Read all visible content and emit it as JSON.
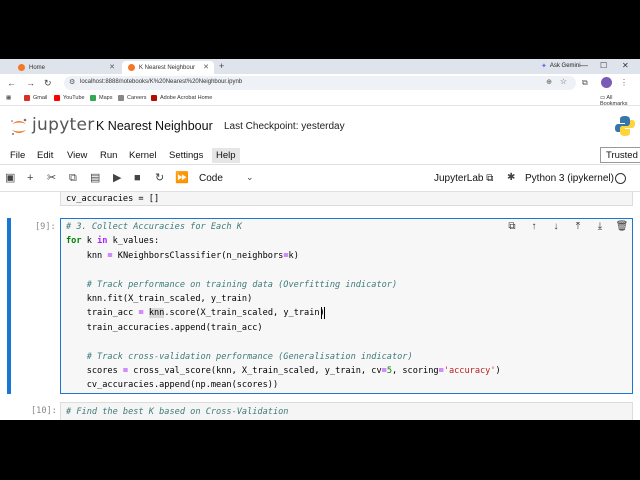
{
  "browser": {
    "tabs": [
      {
        "label": "Home",
        "active": false
      },
      {
        "label": "K Nearest Neighbour",
        "active": true
      }
    ],
    "new_tab": "+",
    "ask_gemini": "Ask Gemini",
    "url": "localhost:8888/notebooks/K%20Nearest%20Neighbour.ipynb",
    "bookmarks": [
      {
        "label": "Gmail",
        "color": "#d93025"
      },
      {
        "label": "YouTube",
        "color": "#ff0000"
      },
      {
        "label": "Maps",
        "color": "#34a853"
      },
      {
        "label": "Careers",
        "color": "#888888"
      },
      {
        "label": "Adobe Acrobat Home",
        "color": "#b30b00"
      }
    ],
    "all_bookmarks": "All Bookmarks"
  },
  "jupyter": {
    "brand": "jupyter",
    "notebook_title": "K Nearest Neighbour",
    "checkpoint": "Last Checkpoint: yesterday",
    "trusted": "Trusted",
    "menu": [
      "File",
      "Edit",
      "View",
      "Run",
      "Kernel",
      "Settings",
      "Help"
    ],
    "active_menu": "Help",
    "cell_type": "Code",
    "jupyterlab_label": "JupyterLab",
    "kernel_name": "Python 3 (ipykernel)",
    "accent": "#1976d2"
  },
  "cells": {
    "previous_line": "cv_accuracies = []",
    "active_prompt": "[9]:",
    "next_prompt": "[10]:",
    "next_line": "# Find the best K based on Cross-Validation"
  }
}
